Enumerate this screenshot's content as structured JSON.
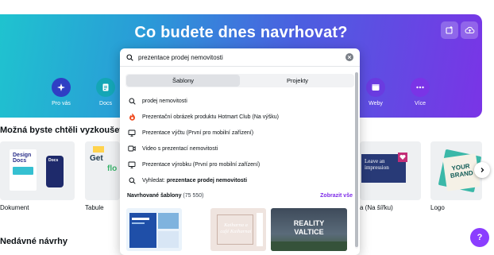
{
  "hero": {
    "title": "Co budete dnes navrhovat?",
    "categories": [
      {
        "label": "Pro vás",
        "icon": "sparkle-icon"
      },
      {
        "label": "Docs",
        "icon": "docs-icon"
      },
      {
        "label": "Weby",
        "icon": "website-icon"
      },
      {
        "label": "Více",
        "icon": "more-icon"
      }
    ]
  },
  "sections": {
    "suggestions_title": "Možná byste chtěli vyzkoušet...",
    "recent_title": "Nedávné návrhy"
  },
  "thumbnails": {
    "dokument": {
      "label": "Dokument",
      "line1": "Design",
      "line2": "Docs",
      "line3": "Docs"
    },
    "tabule": {
      "label": "Tabule",
      "line1": "Get",
      "line2": "flo"
    },
    "na_sirku": {
      "label": "a (Na šířku)",
      "line1": "Leave an",
      "line2": "impression"
    },
    "logo": {
      "label": "Logo",
      "line1": "YOUR",
      "line2": "BRAND"
    }
  },
  "search": {
    "value": "prezentace prodej nemovitosti",
    "tabs": [
      {
        "label": "Šablony",
        "active": true
      },
      {
        "label": "Projekty",
        "active": false
      }
    ],
    "suggestions": [
      {
        "text": "prodej nemovitosti",
        "icon": "search-icon"
      },
      {
        "text": "Prezentační obrázek produktu Hotmart Club (Na výšku)",
        "icon": "hotmart-icon"
      },
      {
        "text": "Prezentace výčtu (První pro mobilní zařízení)",
        "icon": "presentation-icon"
      },
      {
        "text": "Video s prezentací nemovitosti",
        "icon": "video-icon"
      },
      {
        "text": "Prezentace výrobku (První pro mobilní zařízení)",
        "icon": "presentation-icon"
      }
    ],
    "search_for_prefix": "Vyhledat: ",
    "search_for_term": "prezentace prodej nemovitosti",
    "recommended": {
      "title": "Navrhované šablony",
      "count": "(75 550)",
      "show_all": "Zobrazit vše",
      "templates": [
        {
          "text": ""
        },
        {
          "text": "Kaiharna a café Kaiharnai"
        },
        {
          "text": "REALITY VALTICE"
        }
      ]
    }
  },
  "help": {
    "label": "?"
  },
  "colors": {
    "accent": "#8b3dff",
    "link": "#7d2ae8"
  }
}
